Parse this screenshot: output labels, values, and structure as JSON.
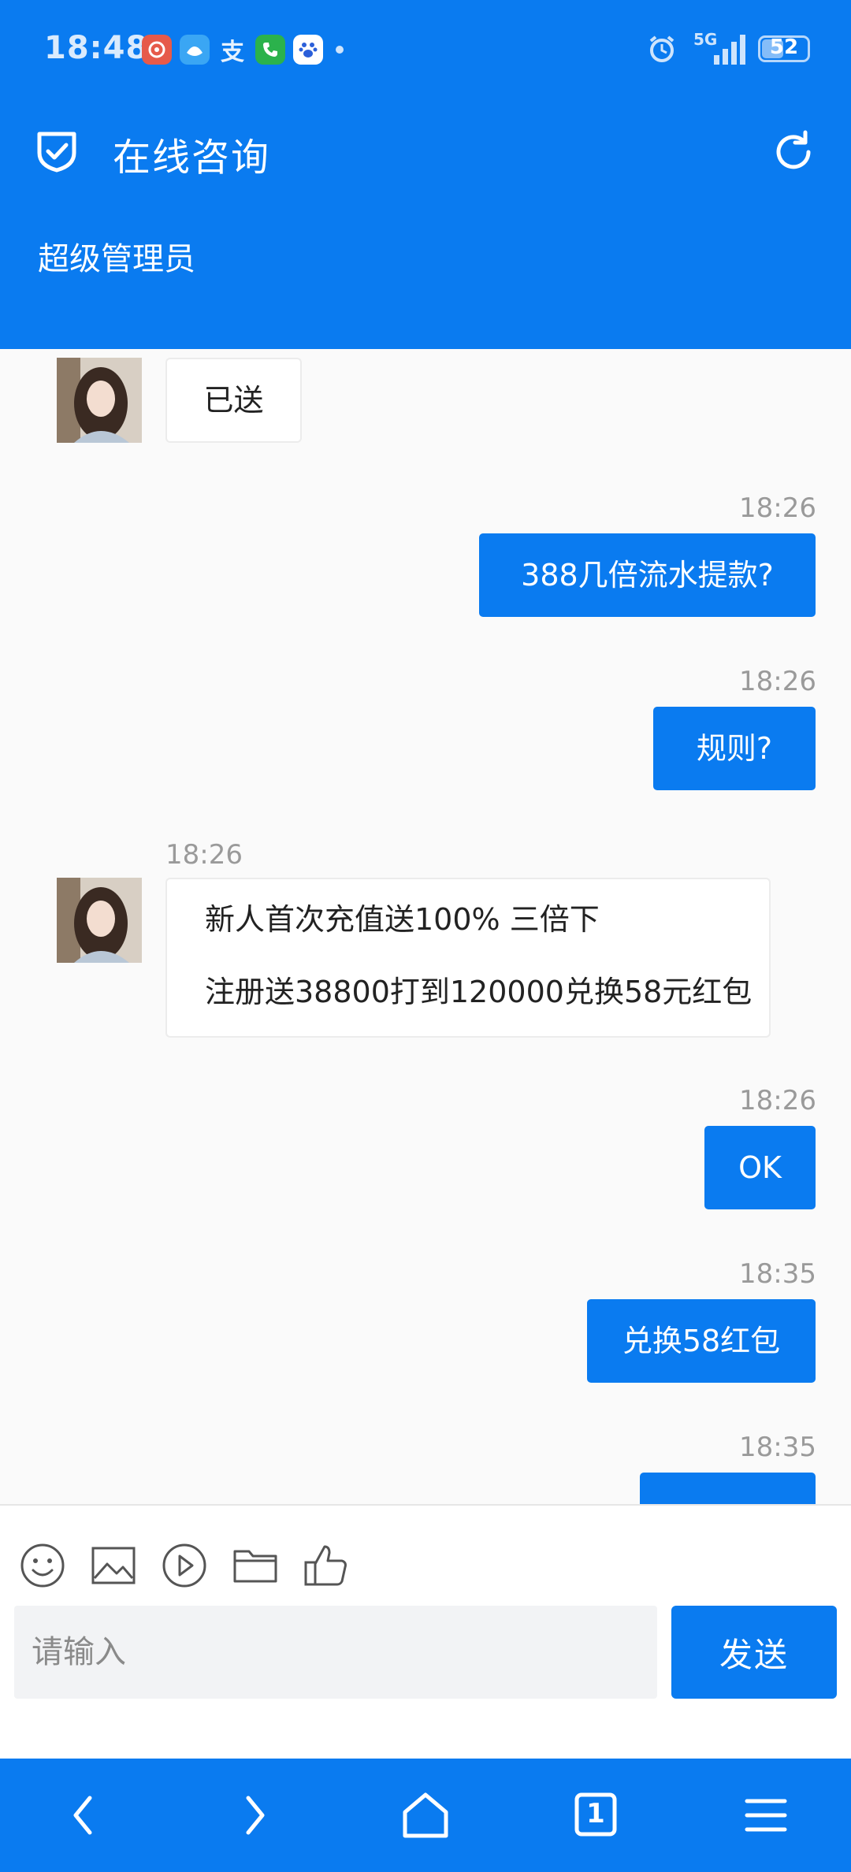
{
  "status_bar": {
    "time": "18:48",
    "network": "5G",
    "battery": "52",
    "battery_level_percent": 52,
    "app_icons": [
      "app-red-icon",
      "app-blue-icon",
      "alipay-icon",
      "phone-icon",
      "baidu-icon"
    ]
  },
  "header": {
    "title": "在线咨询",
    "subtitle": "超级管理员",
    "accent_color": "#0a7bf0"
  },
  "messages": [
    {
      "side": "in",
      "text": "已送"
    },
    {
      "side": "out",
      "time": "18:26",
      "text": "388几倍流水提款?"
    },
    {
      "side": "out",
      "time": "18:26",
      "text": "规则?"
    },
    {
      "side": "in",
      "time": "18:26",
      "lines": [
        "新人首次充值送100% 三倍下",
        "注册送38800打到120000兑换58元红包"
      ]
    },
    {
      "side": "out",
      "time": "18:26",
      "text": "OK"
    },
    {
      "side": "out",
      "time": "18:35",
      "text": "兑换58红包"
    },
    {
      "side": "out",
      "time": "18:35",
      "text": ""
    }
  ],
  "composer": {
    "placeholder": "请输入",
    "send_label": "发送",
    "tools": [
      "emoji-icon",
      "image-icon",
      "video-icon",
      "folder-icon",
      "thumbs-up-icon"
    ]
  },
  "bottom_nav": {
    "tab_count": "1",
    "items": [
      "back-icon",
      "forward-icon",
      "home-icon",
      "tabs-icon",
      "menu-icon"
    ]
  }
}
